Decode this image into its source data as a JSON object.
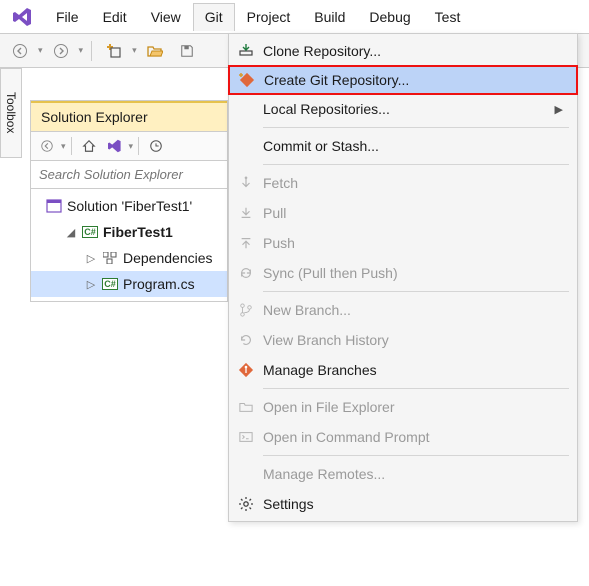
{
  "menubar": {
    "items": [
      "File",
      "Edit",
      "View",
      "Git",
      "Project",
      "Build",
      "Debug",
      "Test"
    ],
    "open_index": 3
  },
  "toolbox_tab": "Toolbox",
  "solution_explorer": {
    "title": "Solution Explorer",
    "search_placeholder": "Search Solution Explorer",
    "tree": {
      "solution": "Solution 'FiberTest1'",
      "project": "FiberTest1",
      "dependencies": "Dependencies",
      "file": "Program.cs"
    }
  },
  "git_menu": {
    "items": [
      {
        "label": "Clone Repository...",
        "enabled": true,
        "icon": "clone",
        "submenu": false
      },
      {
        "label": "Create Git Repository...",
        "enabled": true,
        "icon": "create",
        "submenu": false,
        "highlight": true,
        "boxed": true
      },
      {
        "label": "Local Repositories...",
        "enabled": true,
        "icon": "",
        "submenu": true
      },
      {
        "sep": true
      },
      {
        "label": "Commit or Stash...",
        "enabled": true,
        "icon": "",
        "submenu": false
      },
      {
        "sep": true
      },
      {
        "label": "Fetch",
        "enabled": false,
        "icon": "fetch",
        "submenu": false
      },
      {
        "label": "Pull",
        "enabled": false,
        "icon": "pull",
        "submenu": false
      },
      {
        "label": "Push",
        "enabled": false,
        "icon": "push",
        "submenu": false
      },
      {
        "label": "Sync (Pull then Push)",
        "enabled": false,
        "icon": "sync",
        "submenu": false
      },
      {
        "sep": true
      },
      {
        "label": "New Branch...",
        "enabled": false,
        "icon": "branch",
        "submenu": false
      },
      {
        "label": "View Branch History",
        "enabled": false,
        "icon": "history",
        "submenu": false
      },
      {
        "label": "Manage Branches",
        "enabled": true,
        "icon": "manage",
        "submenu": false
      },
      {
        "sep": true
      },
      {
        "label": "Open in File Explorer",
        "enabled": false,
        "icon": "folder",
        "submenu": false
      },
      {
        "label": "Open in Command Prompt",
        "enabled": false,
        "icon": "terminal",
        "submenu": false
      },
      {
        "sep": true
      },
      {
        "label": "Manage Remotes...",
        "enabled": false,
        "icon": "",
        "submenu": false
      },
      {
        "label": "Settings",
        "enabled": true,
        "icon": "gear",
        "submenu": false
      }
    ]
  }
}
